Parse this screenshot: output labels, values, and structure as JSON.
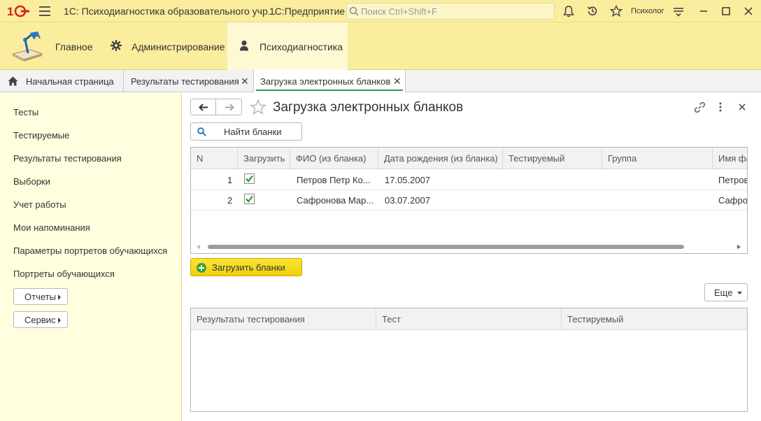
{
  "titlebar": {
    "window_title": "1С: Психодиагностика образовательного учр...",
    "app_name": "1С:Предприятие",
    "search_placeholder": "Поиск Ctrl+Shift+F",
    "user": "Психолог"
  },
  "sections": [
    {
      "label": "Главное",
      "icon": "desk-lamp-icon",
      "active": false
    },
    {
      "label": "Администрирование",
      "icon": "gear-icon",
      "active": false
    },
    {
      "label": "Психодиагностика",
      "icon": "person-icon",
      "active": true
    }
  ],
  "tabs": [
    {
      "label": "Начальная страница",
      "icon": "home-icon",
      "closable": false,
      "active": false
    },
    {
      "label": "Результаты тестирования",
      "closable": true,
      "active": false
    },
    {
      "label": "Загрузка электронных бланков",
      "closable": true,
      "active": true
    }
  ],
  "sidebar": {
    "items": [
      {
        "label": "Тесты"
      },
      {
        "label": "Тестируемые"
      },
      {
        "label": "Результаты тестирования"
      },
      {
        "label": "Выборки"
      },
      {
        "label": "Учет работы"
      },
      {
        "label": "Мои напоминания"
      },
      {
        "label": "Параметры портретов обучающихся"
      },
      {
        "label": "Портреты обучающихся"
      }
    ],
    "buttons": [
      {
        "label": "Отчеты"
      },
      {
        "label": "Сервис"
      }
    ]
  },
  "form": {
    "title": "Загрузка электронных бланков",
    "find_button": "Найти бланки",
    "load_button": "Загрузить бланки",
    "more_button": "Еще"
  },
  "blanks_table": {
    "columns": [
      "N",
      "Загрузить",
      "ФИО (из бланка)",
      "Дата рождения (из бланка)",
      "Тестируемый",
      "Группа",
      "Имя фа"
    ],
    "rows": [
      {
        "n": "1",
        "load": true,
        "fio": "Петров Петр Ко...",
        "birth": "17.05.2007",
        "person": "",
        "group": "",
        "file": "Петров"
      },
      {
        "n": "2",
        "load": true,
        "fio": "Сафронова Мар...",
        "birth": "03.07.2007",
        "person": "",
        "group": "",
        "file": "Сафрон"
      }
    ],
    "scroll_position": 0.02
  },
  "results_table": {
    "columns": [
      "Результаты тестирования",
      "Тест",
      "Тестируемый"
    ],
    "rows": []
  },
  "colors": {
    "header_bg": "#fbed9e",
    "sidebar_bg": "#fffedf",
    "accent_green": "#2a9a4a",
    "primary_button": "#f5d515"
  }
}
